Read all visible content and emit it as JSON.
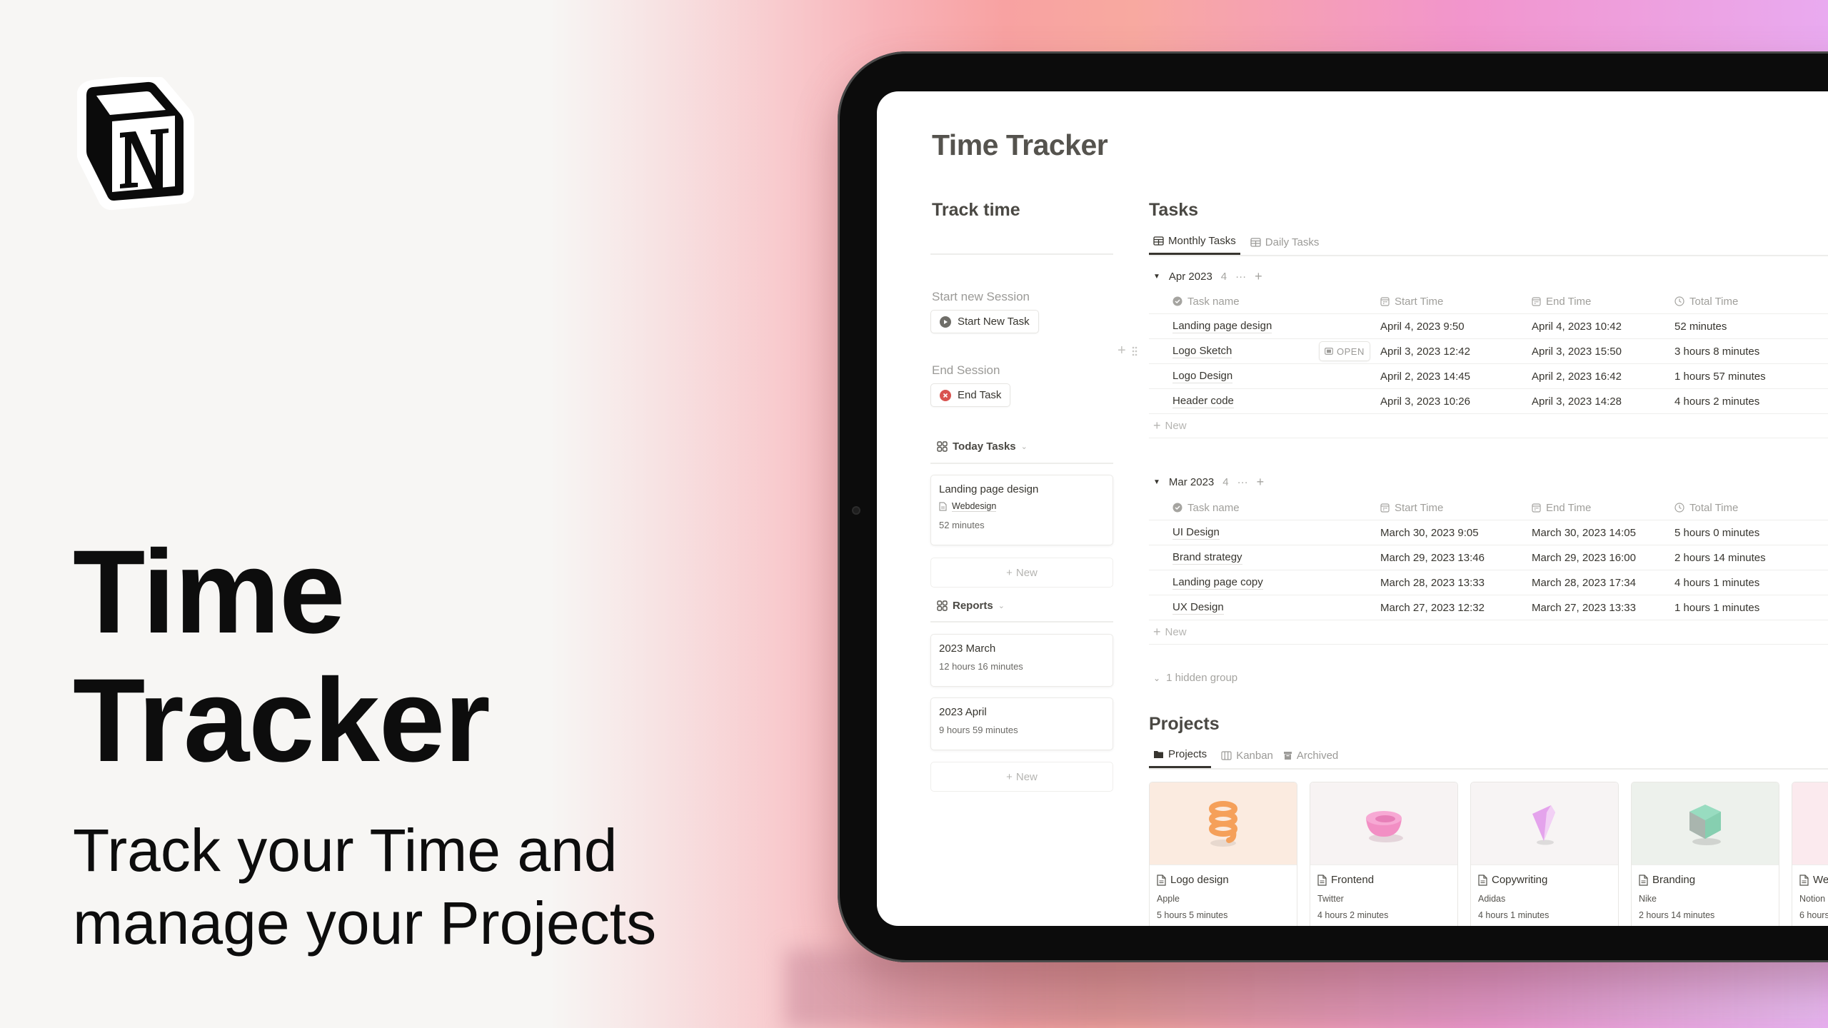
{
  "hero": {
    "title_line1": "Time",
    "title_line2": "Tracker",
    "subtitle_line1": "Track your Time and",
    "subtitle_line2": "manage your Projects"
  },
  "app": {
    "page_title": "Time Tracker",
    "track_time": {
      "heading": "Track time",
      "start_label": "Start new Session",
      "start_button": "Start New Task",
      "end_label": "End Session",
      "end_button": "End Task",
      "today_tasks": {
        "title": "Today Tasks",
        "cards": [
          {
            "title": "Landing page design",
            "project": "Webdesign",
            "duration": "52 minutes"
          }
        ],
        "new_label": "New"
      },
      "reports": {
        "title": "Reports",
        "cards": [
          {
            "title": "2023 March",
            "duration": "12 hours 16 minutes"
          },
          {
            "title": "2023 April",
            "duration": "9 hours 59 minutes"
          }
        ],
        "new_label": "New"
      }
    },
    "tasks": {
      "heading": "Tasks",
      "tabs": [
        {
          "label": "Monthly Tasks",
          "active": true
        },
        {
          "label": "Daily Tasks",
          "active": false
        }
      ],
      "columns": [
        "Task name",
        "Start Time",
        "End Time",
        "Total Time"
      ],
      "open_label": "OPEN",
      "new_label": "New",
      "groups": [
        {
          "label": "Apr 2023",
          "count": "4",
          "rows": [
            {
              "name": "Landing page design",
              "start": "April 4, 2023 9:50",
              "end": "April 4, 2023 10:42",
              "total": "52 minutes"
            },
            {
              "name": "Logo Sketch",
              "start": "April 3, 2023 12:42",
              "end": "April 3, 2023 15:50",
              "total": "3 hours 8 minutes"
            },
            {
              "name": "Logo Design",
              "start": "April 2, 2023 14:45",
              "end": "April 2, 2023 16:42",
              "total": "1 hours 57 minutes"
            },
            {
              "name": "Header code",
              "start": "April 3, 2023 10:26",
              "end": "April 3, 2023 14:28",
              "total": "4 hours 2 minutes"
            }
          ]
        },
        {
          "label": "Mar 2023",
          "count": "4",
          "rows": [
            {
              "name": "UI Design",
              "start": "March 30, 2023 9:05",
              "end": "March 30, 2023 14:05",
              "total": "5 hours 0 minutes"
            },
            {
              "name": "Brand strategy",
              "start": "March 29, 2023 13:46",
              "end": "March 29, 2023 16:00",
              "total": "2 hours 14 minutes"
            },
            {
              "name": "Landing page copy",
              "start": "March 28, 2023 13:33",
              "end": "March 28, 2023 17:34",
              "total": "4 hours 1 minutes"
            },
            {
              "name": "UX Design",
              "start": "March 27, 2023 12:32",
              "end": "March 27, 2023 13:33",
              "total": "1 hours 1 minutes"
            }
          ]
        }
      ],
      "hidden_groups": "1 hidden group"
    },
    "projects": {
      "heading": "Projects",
      "tabs": [
        {
          "label": "Projects",
          "active": true
        },
        {
          "label": "Kanban",
          "active": false
        },
        {
          "label": "Archived",
          "active": false
        }
      ],
      "cards": [
        {
          "title": "Logo design",
          "client": "Apple",
          "duration": "5 hours 5 minutes",
          "cover_color": "#fbebe0",
          "shape_color": "#f5a05a"
        },
        {
          "title": "Frontend",
          "client": "Twitter",
          "duration": "4 hours 2 minutes",
          "cover_color": "#f7f3f3",
          "shape_color": "#f28fc4"
        },
        {
          "title": "Copywriting",
          "client": "Adidas",
          "duration": "4 hours 1 minutes",
          "cover_color": "#f7f4f4",
          "shape_color": "#e4a3ec"
        },
        {
          "title": "Branding",
          "client": "Nike",
          "duration": "2 hours 14 minutes",
          "cover_color": "#edf1ec",
          "shape_color": "#98dcc0"
        },
        {
          "title": "We",
          "client": "Notion",
          "duration": "6 hours",
          "cover_color": "#fbeaee",
          "shape_color": "#f5c6d2"
        }
      ]
    }
  }
}
